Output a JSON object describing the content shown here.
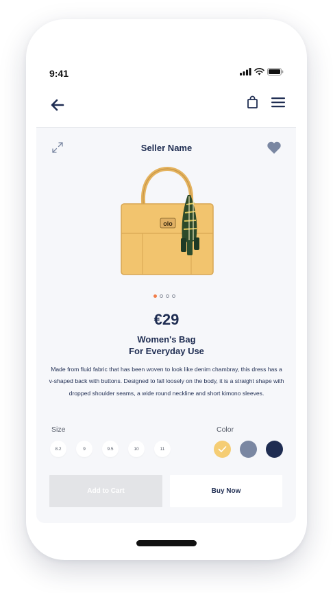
{
  "status_bar": {
    "time": "9:41",
    "icons": [
      "signal-icon",
      "wifi-icon",
      "battery-icon"
    ]
  },
  "nav": {
    "back_icon": "arrow-left-icon",
    "bag_icon": "shopping-bag-icon",
    "menu_icon": "hamburger-menu-icon"
  },
  "product": {
    "seller": "Seller Name",
    "price": "€29",
    "title_line1": "Women's Bag",
    "title_line2": "For Everyday Use",
    "description": "Made from fluid fabric that has been woven to look like denim chambray, this dress has a v-shaped back with buttons. Designed to fall loosely on the body, it is a straight shape with dropped shoulder seams, a wide round neckline and short kimono sleeves.",
    "image_icon": "handbag-image",
    "carousel": {
      "count": 4,
      "active_index": 0
    }
  },
  "options": {
    "size_label": "Size",
    "sizes": [
      "8.2",
      "9",
      "9.5",
      "10",
      "11"
    ],
    "color_label": "Color",
    "colors": [
      {
        "name": "yellow",
        "hex": "#f5cd74",
        "selected": true
      },
      {
        "name": "gray-blue",
        "hex": "#7a87a2",
        "selected": false
      },
      {
        "name": "navy",
        "hex": "#1f2d52",
        "selected": false
      }
    ]
  },
  "actions": {
    "add_to_cart": "Add to Cart",
    "buy_now": "Buy Now"
  },
  "colors": {
    "primary": "#1f2d52",
    "accent": "#f17e4a",
    "card_bg": "#f6f7fa"
  }
}
